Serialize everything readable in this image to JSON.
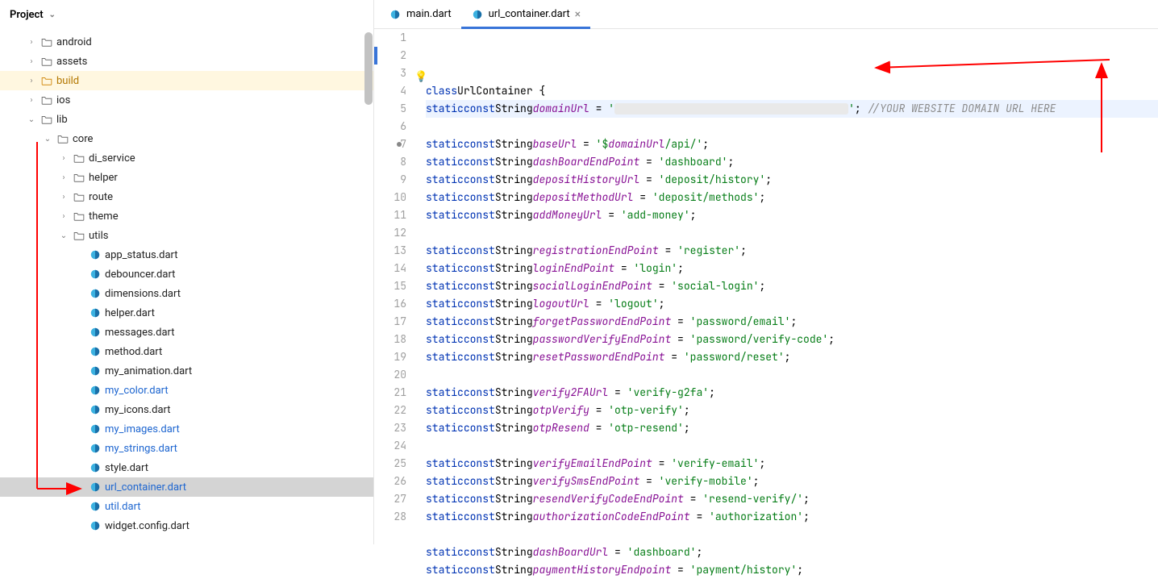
{
  "project": {
    "label": "Project"
  },
  "tree": [
    {
      "depth": 1,
      "chev": "right",
      "icon": "folder",
      "label": "android"
    },
    {
      "depth": 1,
      "chev": "right",
      "icon": "folder",
      "label": "assets"
    },
    {
      "depth": 1,
      "chev": "right",
      "icon": "folder-hl",
      "label": "build",
      "highlight": true
    },
    {
      "depth": 1,
      "chev": "right",
      "icon": "folder",
      "label": "ios"
    },
    {
      "depth": 1,
      "chev": "down",
      "icon": "folder",
      "label": "lib"
    },
    {
      "depth": 2,
      "chev": "down",
      "icon": "folder",
      "label": "core"
    },
    {
      "depth": 3,
      "chev": "right",
      "icon": "folder",
      "label": "di_service"
    },
    {
      "depth": 3,
      "chev": "right",
      "icon": "folder",
      "label": "helper"
    },
    {
      "depth": 3,
      "chev": "right",
      "icon": "folder",
      "label": "route"
    },
    {
      "depth": 3,
      "chev": "right",
      "icon": "folder",
      "label": "theme"
    },
    {
      "depth": 3,
      "chev": "down",
      "icon": "folder",
      "label": "utils"
    },
    {
      "depth": 4,
      "icon": "dart",
      "label": "app_status.dart"
    },
    {
      "depth": 4,
      "icon": "dart",
      "label": "debouncer.dart"
    },
    {
      "depth": 4,
      "icon": "dart",
      "label": "dimensions.dart"
    },
    {
      "depth": 4,
      "icon": "dart",
      "label": "helper.dart"
    },
    {
      "depth": 4,
      "icon": "dart",
      "label": "messages.dart"
    },
    {
      "depth": 4,
      "icon": "dart",
      "label": "method.dart"
    },
    {
      "depth": 4,
      "icon": "dart",
      "label": "my_animation.dart"
    },
    {
      "depth": 4,
      "icon": "dart",
      "label": "my_color.dart",
      "blue": true
    },
    {
      "depth": 4,
      "icon": "dart",
      "label": "my_icons.dart"
    },
    {
      "depth": 4,
      "icon": "dart",
      "label": "my_images.dart",
      "blue": true
    },
    {
      "depth": 4,
      "icon": "dart",
      "label": "my_strings.dart",
      "blue": true
    },
    {
      "depth": 4,
      "icon": "dart",
      "label": "style.dart"
    },
    {
      "depth": 4,
      "icon": "dart",
      "label": "url_container.dart",
      "blue": true,
      "selected": true
    },
    {
      "depth": 4,
      "icon": "dart",
      "label": "util.dart",
      "blue": true
    },
    {
      "depth": 4,
      "icon": "dart",
      "label": "widget.config.dart"
    }
  ],
  "tabs": [
    {
      "label": "main.dart",
      "active": false
    },
    {
      "label": "url_container.dart",
      "active": true
    }
  ],
  "code": {
    "class_name": "UrlContainer",
    "comment_domain": "//YOUR WEBSITE DOMAIN URL HERE",
    "lines": [
      {
        "n": 1,
        "type": "class_open"
      },
      {
        "n": 2,
        "type": "decl_redact",
        "name": "domainUrl",
        "comment": true,
        "hl": true
      },
      {
        "n": 3,
        "type": "blank_bulb"
      },
      {
        "n": 4,
        "type": "decl_interp",
        "name": "baseUrl",
        "prefix": "$",
        "var": "domainUrl",
        "suffix": "/api/",
        "brk": true
      },
      {
        "n": 5,
        "type": "decl_str",
        "name": "dashBoardEndPoint",
        "val": "dashboard"
      },
      {
        "n": 6,
        "type": "decl_str",
        "name": "depositHistoryUrl",
        "val": "deposit/history"
      },
      {
        "n": 7,
        "type": "decl_str",
        "name": "depositMethodUrl",
        "val": "deposit/methods"
      },
      {
        "n": 8,
        "type": "decl_str",
        "name": "addMoneyUrl",
        "val": "add-money"
      },
      {
        "n": 9,
        "type": "blank"
      },
      {
        "n": 10,
        "type": "decl_str",
        "name": "registrationEndPoint",
        "val": "register"
      },
      {
        "n": 11,
        "type": "decl_str",
        "name": "loginEndPoint",
        "val": "login"
      },
      {
        "n": 12,
        "type": "decl_str",
        "name": "socialLoginEndPoint",
        "val": "social-login"
      },
      {
        "n": 13,
        "type": "decl_str",
        "name": "logoutUrl",
        "val": "logout"
      },
      {
        "n": 14,
        "type": "decl_str",
        "name": "forgetPasswordEndPoint",
        "val": "password/email"
      },
      {
        "n": 15,
        "type": "decl_str",
        "name": "passwordVerifyEndPoint",
        "val": "password/verify-code"
      },
      {
        "n": 16,
        "type": "decl_str",
        "name": "resetPasswordEndPoint",
        "val": "password/reset"
      },
      {
        "n": 17,
        "type": "blank"
      },
      {
        "n": 18,
        "type": "decl_str",
        "name": "verify2FAUrl",
        "val": "verify-g2fa"
      },
      {
        "n": 19,
        "type": "decl_str",
        "name": "otpVerify",
        "val": "otp-verify"
      },
      {
        "n": 20,
        "type": "decl_str",
        "name": "otpResend",
        "val": "otp-resend"
      },
      {
        "n": 21,
        "type": "blank"
      },
      {
        "n": 22,
        "type": "decl_str",
        "name": "verifyEmailEndPoint",
        "val": "verify-email"
      },
      {
        "n": 23,
        "type": "decl_str",
        "name": "verifySmsEndPoint",
        "val": "verify-mobile"
      },
      {
        "n": 24,
        "type": "decl_str",
        "name": "resendVerifyCodeEndPoint",
        "val": "resend-verify/"
      },
      {
        "n": 25,
        "type": "decl_str",
        "name": "authorizationCodeEndPoint",
        "val": "authorization"
      },
      {
        "n": 26,
        "type": "blank"
      },
      {
        "n": 27,
        "type": "decl_str",
        "name": "dashBoardUrl",
        "val": "dashboard"
      },
      {
        "n": 28,
        "type": "decl_str",
        "name": "paymentHistoryEndpoint",
        "val": "payment/history"
      }
    ]
  }
}
